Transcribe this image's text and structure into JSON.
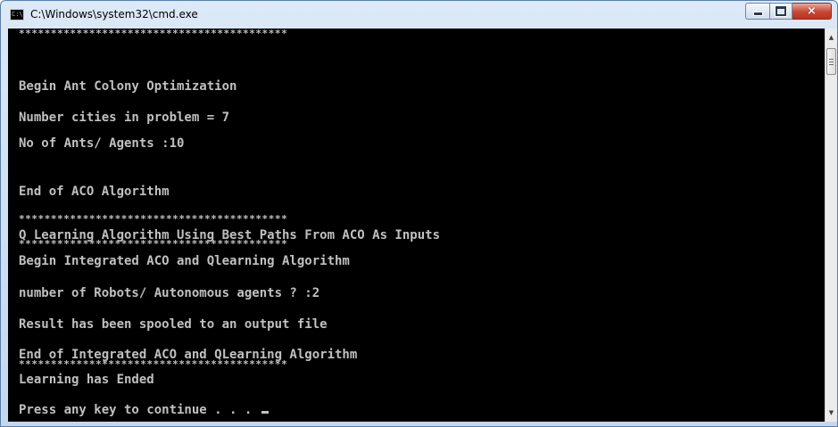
{
  "window": {
    "title": "C:\\Windows\\system32\\cmd.exe",
    "icon": "cmd-icon",
    "icon_text": "C:\\",
    "buttons": {
      "minimize": "minimize-icon",
      "maximize": "maximize-icon",
      "close": "×"
    }
  },
  "console": {
    "background": "#000000",
    "foreground": "#c0c0c0",
    "lines": [
      "******************************************",
      "Begin Ant Colony Optimization",
      "Number cities in problem = 7",
      "No of Ants/ Agents :10",
      "End of ACO Algorithm",
      "******************************************",
      "Q Learning Algorithm Using Best Paths From ACO As Inputs",
      "******************************************",
      "Begin Integrated ACO and Qlearning Algorithm",
      "number of Robots/ Autonomous agents ? :2",
      "Result has been spooled to an output file",
      "End of Integrated ACO and QLearning Algorithm",
      "******************************************",
      "Learning has Ended",
      "Press any key to continue . . . "
    ]
  },
  "scrollbar": {
    "up_arrow": "▲",
    "down_arrow": "▼"
  }
}
